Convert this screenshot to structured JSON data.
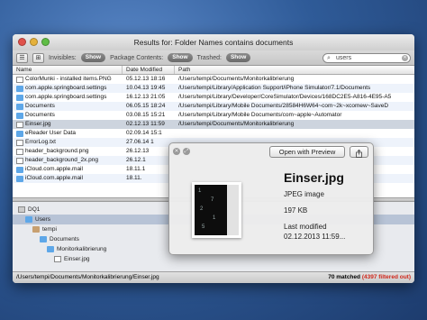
{
  "window": {
    "title": "Results for: Folder Names contains documents"
  },
  "toolbar": {
    "invisibles_label": "Invisibles:",
    "invisibles_value": "Show",
    "package_label": "Package Contents:",
    "package_value": "Show",
    "trashed_label": "Trashed:",
    "trashed_value": "Show",
    "search_value": "users"
  },
  "columns": {
    "name": "Name",
    "date": "Date Modified",
    "path": "Path"
  },
  "rows": [
    {
      "name": "ColorMunki - installed items.PNG",
      "date": "05.12.13 18:16",
      "path": "/Users/tempi/Documents/Monitorkalibrierung",
      "icon": "doc"
    },
    {
      "name": "com.apple.springboard.settings",
      "date": "10.04.13 19:45",
      "path": "/Users/tempi/Library/Application Support/iPhone Simulator/7.1/Documents",
      "icon": "folder"
    },
    {
      "name": "com.apple.springboard.settings",
      "date": "16.12.13 21:05",
      "path": "/Users/tempi/Library/Developer/CoreSimulator/Devices/168DC2E5-A816-4E95-A5",
      "icon": "folder"
    },
    {
      "name": "Documents",
      "date": "06.05.15 18:24",
      "path": "/Users/tempi/Library/Mobile Documents/28584H6W64~com~2k~xcomew~SaveD",
      "icon": "folder"
    },
    {
      "name": "Documents",
      "date": "03.08.15 15:21",
      "path": "/Users/tempi/Library/Mobile Documents/com~apple~Automator",
      "icon": "folder"
    },
    {
      "name": "Einser.jpg",
      "date": "02.12.13 11:59",
      "path": "/Users/tempi/Documents/Monitorkalibrierung",
      "icon": "doc"
    },
    {
      "name": "eReader User Data",
      "date": "02.09.14 15:1",
      "path": "",
      "icon": "folder"
    },
    {
      "name": "ErrorLog.txt",
      "date": "27.06.14 1",
      "path": "",
      "icon": "doc"
    },
    {
      "name": "header_background.png",
      "date": "26.12.13",
      "path": "",
      "icon": "doc"
    },
    {
      "name": "header_background_2x.png",
      "date": "26.12.1",
      "path": "",
      "icon": "doc"
    },
    {
      "name": "iCloud.com.apple.mail",
      "date": "18.11.1",
      "path": "",
      "icon": "folder"
    },
    {
      "name": "iCloud.com.apple.mail",
      "date": "18.11.",
      "path": "",
      "icon": "folder"
    },
    {
      "name": "",
      "date": "",
      "path": "",
      "icon": ""
    }
  ],
  "tree": {
    "root": "DQ1",
    "items": [
      "Users",
      "tempi",
      "Documents",
      "Monitorkalibrierung",
      "Einser.jpg"
    ]
  },
  "status": {
    "path": "/Users/tempi/Documents/Monitorkalibrierung/Einser.jpg",
    "matched": "70 matched",
    "filtered": "(4397 filtered out)"
  },
  "popover": {
    "open_button": "Open with Preview",
    "filename": "Einser.jpg",
    "kind": "JPEG image",
    "size": "197 KB",
    "modified_label": "Last modified",
    "modified_value": "02.12.2013 11:59..."
  }
}
